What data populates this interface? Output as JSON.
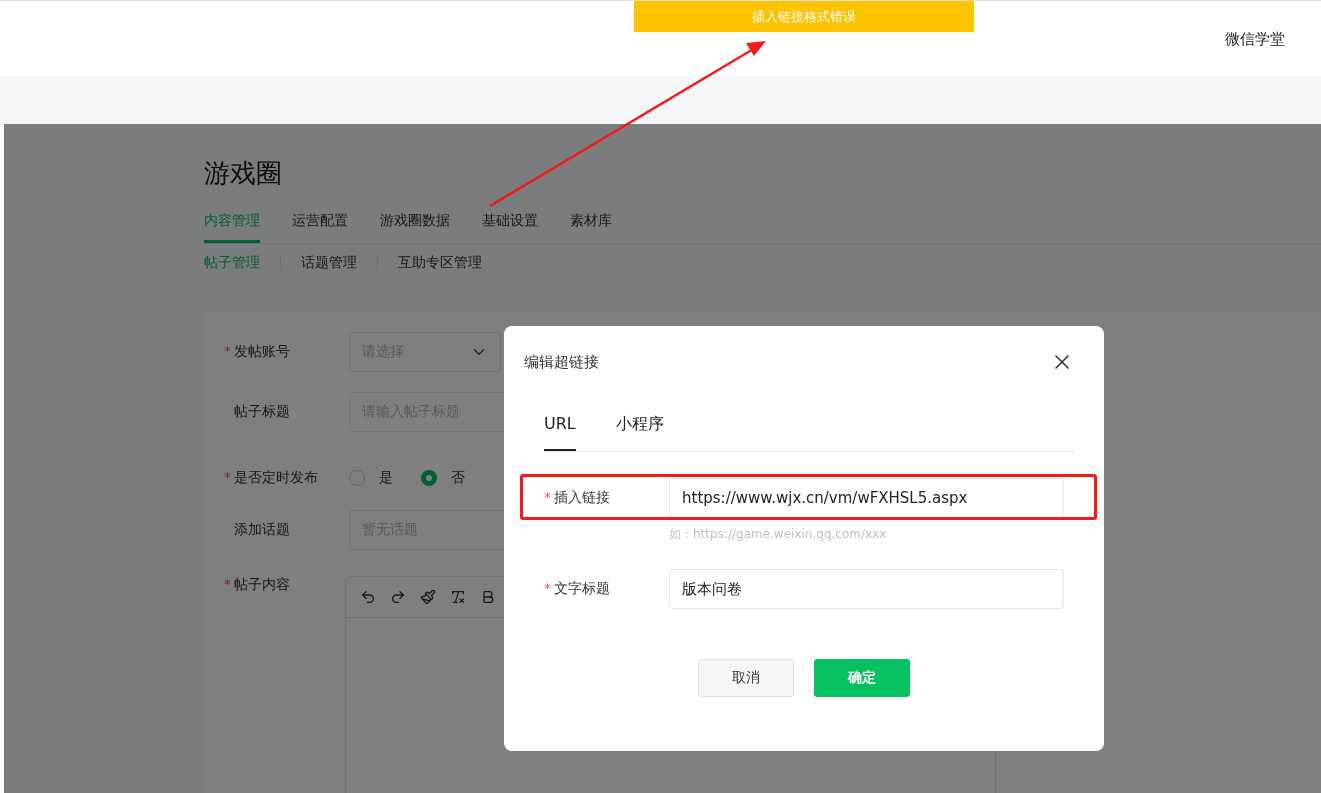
{
  "toast": {
    "message": "插入链接格式错误"
  },
  "header": {
    "link": "微信学堂"
  },
  "page": {
    "title": "游戏圈",
    "tabs": [
      {
        "label": "内容管理",
        "selected": true
      },
      {
        "label": "运营配置",
        "selected": false
      },
      {
        "label": "游戏圈数据",
        "selected": false
      },
      {
        "label": "基础设置",
        "selected": false
      },
      {
        "label": "素材库",
        "selected": false
      }
    ],
    "subtabs": [
      {
        "label": "帖子管理",
        "selected": true
      },
      {
        "label": "话题管理",
        "selected": false
      },
      {
        "label": "互助专区管理",
        "selected": false
      }
    ],
    "form": {
      "required_marker": "*",
      "fields": [
        {
          "kind": "select",
          "label": "发帖账号",
          "required": true,
          "placeholder": "请选择"
        },
        {
          "kind": "text",
          "label": "帖子标题",
          "required": false,
          "placeholder": "请输入帖子标题"
        },
        {
          "kind": "radio",
          "label": "是否定时发布",
          "required": true,
          "options": [
            {
              "label": "是",
              "selected": false
            },
            {
              "label": "否",
              "selected": true
            }
          ]
        },
        {
          "kind": "text",
          "label": "添加话题",
          "required": false,
          "placeholder": "暂无话题"
        },
        {
          "kind": "editor",
          "label": "帖子内容",
          "required": true
        }
      ]
    }
  },
  "dialog": {
    "title": "编辑超链接",
    "required_marker": "*",
    "tabs": [
      {
        "label": "URL",
        "selected": true
      },
      {
        "label": "小程序",
        "selected": false
      }
    ],
    "fields": [
      {
        "label": "插入链接",
        "required": true,
        "value": "https://www.wjx.cn/vm/wFXHSL5.aspx",
        "hint": "如：https://game.weixin.qq.com/xxx",
        "highlighted": true
      },
      {
        "label": "文字标题",
        "required": true,
        "value": "版本问卷",
        "highlighted": false
      }
    ],
    "buttons": [
      {
        "label": "取消",
        "kind": "secondary"
      },
      {
        "label": "确定",
        "kind": "primary"
      }
    ]
  }
}
